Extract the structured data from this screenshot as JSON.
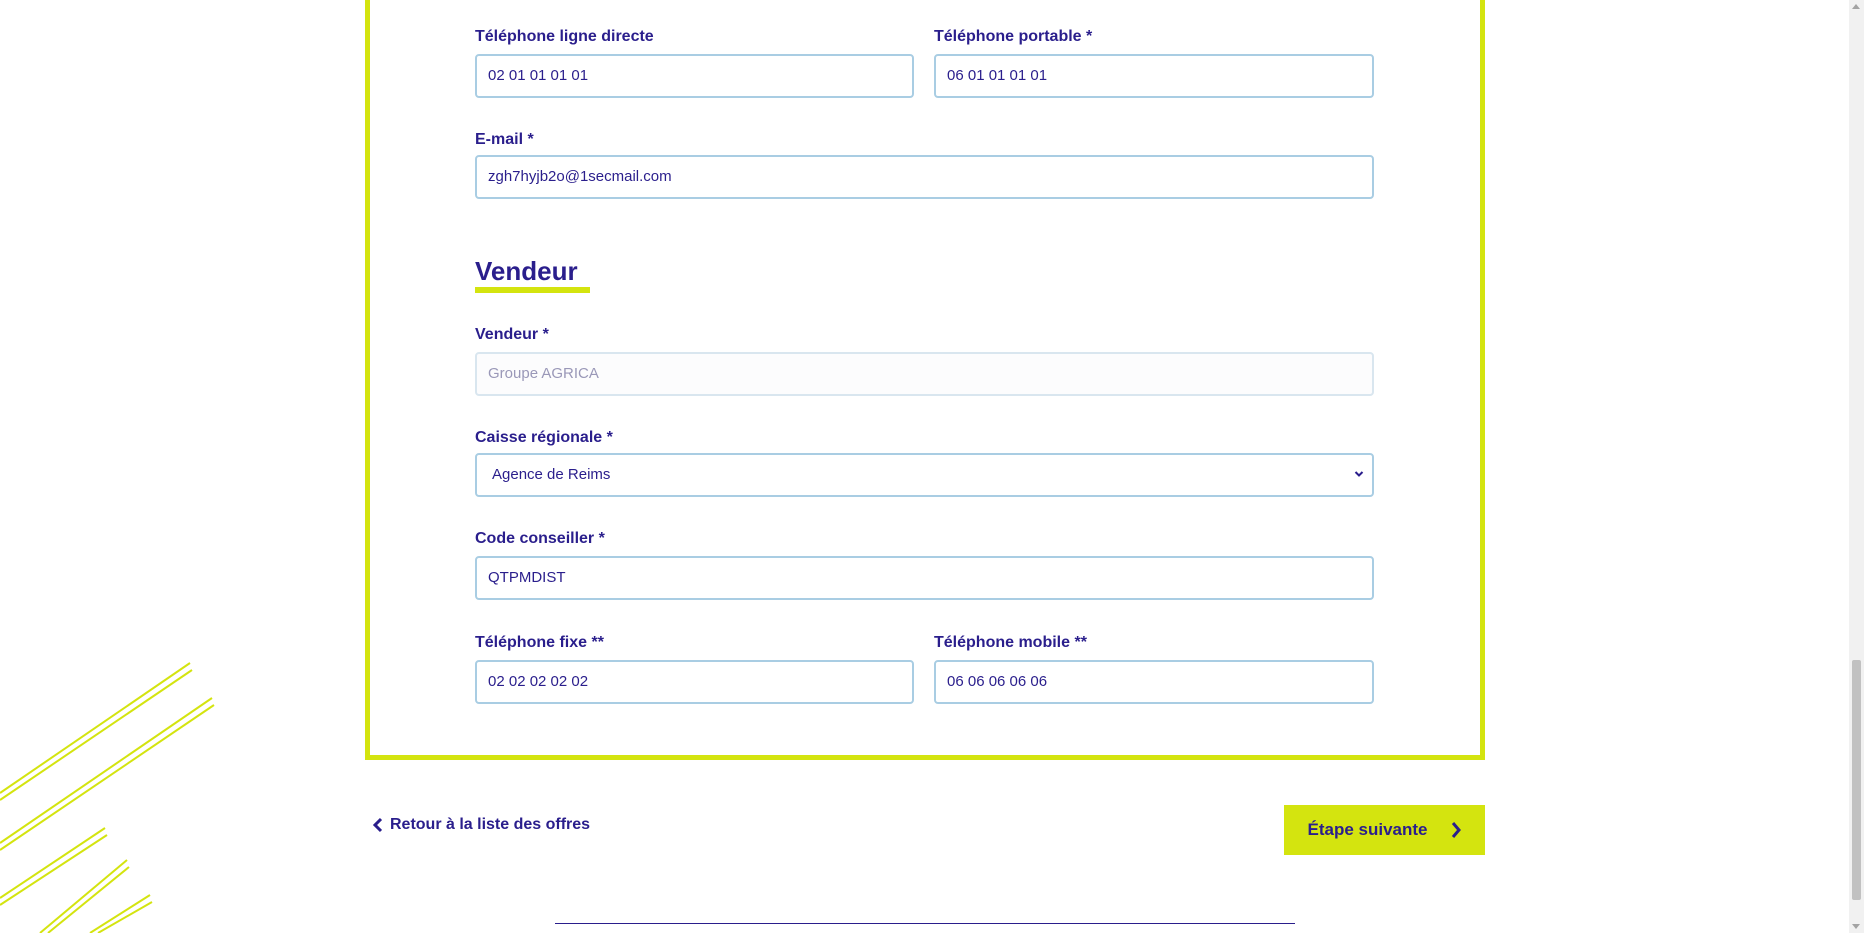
{
  "contact": {
    "direct_phone": {
      "label": "Téléphone ligne directe",
      "value": "02 01 01 01 01"
    },
    "mobile_phone": {
      "label": "Téléphone portable *",
      "value": "06 01 01 01 01"
    },
    "email": {
      "label": "E-mail *",
      "value": "zgh7hyjb2o@1secmail.com"
    }
  },
  "seller_section": {
    "title": "Vendeur",
    "seller": {
      "label": "Vendeur *",
      "placeholder": "Groupe AGRICA"
    },
    "regional_bank": {
      "label": "Caisse régionale *",
      "selected": "Agence de Reims"
    },
    "advisor_code": {
      "label": "Code conseiller *",
      "value": "QTPMDIST"
    },
    "landline": {
      "label": "Téléphone fixe **",
      "value": "02 02 02 02 02"
    },
    "cellphone": {
      "label": "Téléphone mobile **",
      "value": "06 06 06 06 06"
    }
  },
  "navigation": {
    "back_label": "Retour à la liste des offres",
    "next_label": "Étape suivante"
  },
  "colors": {
    "accent": "#d4e40f",
    "text": "#2a1e8c",
    "input_border": "#a9cde3"
  }
}
